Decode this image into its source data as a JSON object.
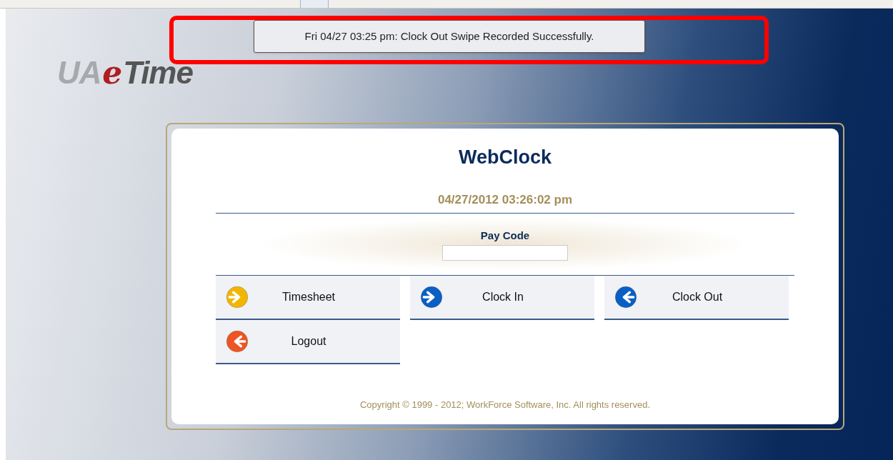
{
  "notification": {
    "message": "Fri 04/27 03:25 pm: Clock Out Swipe Recorded Successfully."
  },
  "logo": {
    "prefix": "UA",
    "middle": "e",
    "suffix": "Time"
  },
  "title": "WebClock",
  "datetime": "04/27/2012 03:26:02 pm",
  "pay_code": {
    "label": "Pay Code"
  },
  "actions": [
    {
      "label": "Timesheet",
      "kind": "forward",
      "color": "#f2b600"
    },
    {
      "label": "Clock In",
      "kind": "forward",
      "color": "#0a5fc4"
    },
    {
      "label": "Clock Out",
      "kind": "back",
      "color": "#0a5fc4"
    },
    {
      "label": "Logout",
      "kind": "back",
      "color": "#ee5522"
    }
  ],
  "copyright": "Copyright © 1999 - 2012; WorkForce Software, Inc.  All rights reserved."
}
